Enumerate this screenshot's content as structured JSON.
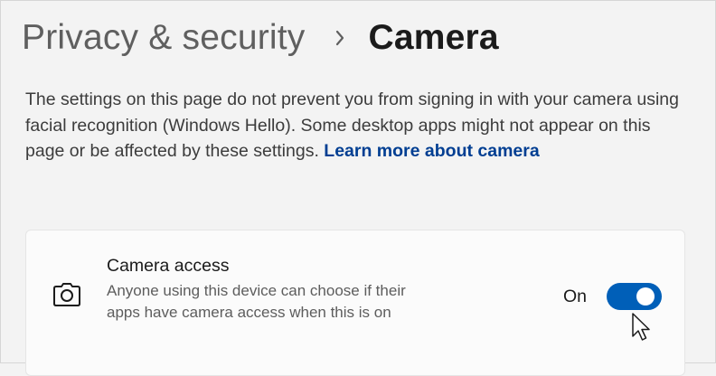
{
  "breadcrumb": {
    "parent": "Privacy & security",
    "separator_icon": "chevron-right-icon",
    "current": "Camera"
  },
  "description": {
    "text": "The settings on this page do not prevent you from signing in with your camera using facial recognition (Windows Hello). Some desktop apps might not appear on this page or be affected by these settings.",
    "link": "Learn more about camera"
  },
  "camera_access": {
    "icon": "camera-icon",
    "title": "Camera access",
    "description": "Anyone using this device can choose if their apps have camera access when this is on",
    "toggle_label": "On",
    "toggle_state": true
  },
  "colors": {
    "accent": "#005fb8",
    "link": "#003e92",
    "background": "#f3f3f3",
    "card": "#fbfbfb"
  }
}
